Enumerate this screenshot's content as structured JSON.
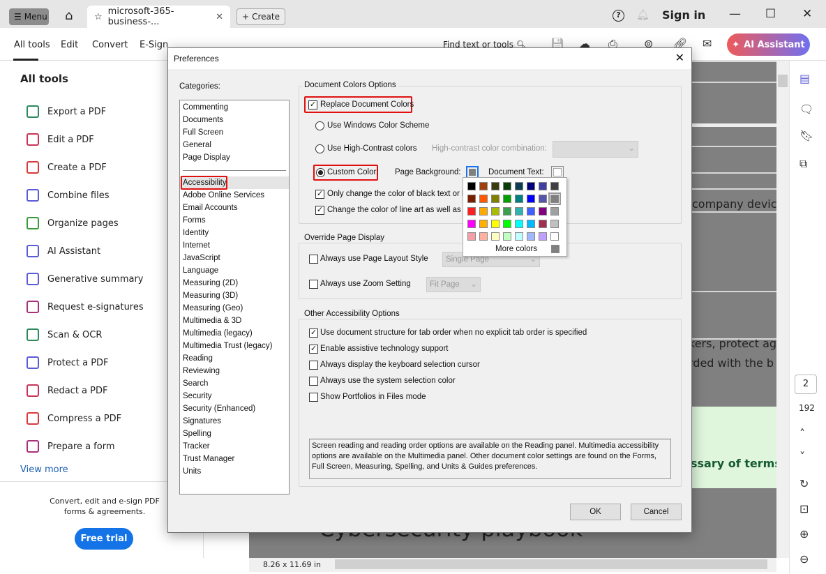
{
  "titlebar": {
    "menu": "Menu",
    "tab_title": "microsoft-365-business-...",
    "create": "Create",
    "sign_in": "Sign in"
  },
  "toolbar": {
    "tabs": [
      "All tools",
      "Edit",
      "Convert",
      "E-Sign"
    ],
    "find": "Find text or tools",
    "ai_assistant": "AI Assistant"
  },
  "left_panel": {
    "title": "All tools",
    "items": [
      {
        "label": "Export a PDF",
        "color": "#2a8a5c"
      },
      {
        "label": "Edit a PDF",
        "color": "#c8345a"
      },
      {
        "label": "Create a PDF",
        "color": "#d8393c"
      },
      {
        "label": "Combine files",
        "color": "#5b5bd6"
      },
      {
        "label": "Organize pages",
        "color": "#3a9a3a"
      },
      {
        "label": "AI Assistant",
        "color": "#5b5bd6"
      },
      {
        "label": "Generative summary",
        "color": "#5b5bd6"
      },
      {
        "label": "Request e-signatures",
        "color": "#a8307a"
      },
      {
        "label": "Scan & OCR",
        "color": "#2a8a5c"
      },
      {
        "label": "Protect a PDF",
        "color": "#5b5bd6"
      },
      {
        "label": "Redact a PDF",
        "color": "#c8345a"
      },
      {
        "label": "Compress a PDF",
        "color": "#d8393c"
      },
      {
        "label": "Prepare a form",
        "color": "#a8307a"
      }
    ],
    "view_more": "View more",
    "promo": "Convert, edit and e-sign PDF forms & agreements.",
    "free_trial": "Free trial"
  },
  "document": {
    "snippets": [
      "company devices",
      "kers, protect ag",
      "rded with the b",
      "ssary of terms.",
      "Cybersecurity playbook"
    ],
    "page_size": "8.26 x 11.69 in"
  },
  "right_rail": {
    "page": "2",
    "total": "192"
  },
  "dialog": {
    "title": "Preferences",
    "categories_label": "Categories:",
    "categories_top": [
      "Commenting",
      "Documents",
      "Full Screen",
      "General",
      "Page Display"
    ],
    "categories": [
      "Accessibility",
      "Adobe Online Services",
      "Email Accounts",
      "Forms",
      "Identity",
      "Internet",
      "JavaScript",
      "Language",
      "Measuring (2D)",
      "Measuring (3D)",
      "Measuring (Geo)",
      "Multimedia & 3D",
      "Multimedia (legacy)",
      "Multimedia Trust (legacy)",
      "Reading",
      "Reviewing",
      "Search",
      "Security",
      "Security (Enhanced)",
      "Signatures",
      "Spelling",
      "Tracker",
      "Trust Manager",
      "Units"
    ],
    "selected_category": "Accessibility",
    "doc_colors": {
      "group": "Document Colors Options",
      "replace": "Replace Document Colors",
      "replace_checked": true,
      "windows": "Use Windows Color Scheme",
      "high_contrast": "Use High-Contrast colors",
      "hc_combo_label": "High-contrast color combination:",
      "custom": "Custom Color:",
      "custom_selected": true,
      "page_bg": "Page Background:",
      "page_bg_color": "#808080",
      "doc_text": "Document Text:",
      "doc_text_color": "#ffffff",
      "only_black": "Only change the color of black text or li",
      "only_black_checked": true,
      "line_art": "Change the color of line art as well as t",
      "line_art_checked": true
    },
    "override": {
      "group": "Override Page Display",
      "layout": "Always use Page Layout Style",
      "layout_value": "Single Page",
      "zoom": "Always use Zoom Setting",
      "zoom_value": "Fit Page"
    },
    "other": {
      "group": "Other Accessibility Options",
      "options": [
        {
          "label": "Use document structure for tab order when no explicit tab order is specified",
          "checked": true
        },
        {
          "label": "Enable assistive technology support",
          "checked": true
        },
        {
          "label": "Always display the keyboard selection cursor",
          "checked": false
        },
        {
          "label": "Always use the system selection color",
          "checked": false
        },
        {
          "label": "Show Portfolios in Files mode",
          "checked": false
        }
      ],
      "info": "Screen reading and reading order options are available on the Reading panel. Multimedia accessibility options are available on the Multimedia panel. Other document color settings are found on the Forms, Full Screen, Measuring, Spelling, and Units & Guides preferences."
    },
    "ok": "OK",
    "cancel": "Cancel",
    "palette": {
      "more_colors": "More colors",
      "selected": "#808080",
      "colors": [
        "#000000",
        "#a0410d",
        "#3b3b0e",
        "#0b3d0b",
        "#0d3d52",
        "#00007a",
        "#4040a0",
        "#404040",
        "#7a2000",
        "#ff5a00",
        "#808000",
        "#00a000",
        "#008080",
        "#0000ff",
        "#5555aa",
        "#808080",
        "#ff2020",
        "#ffaa00",
        "#aabb00",
        "#3aa050",
        "#33b0b0",
        "#4060ff",
        "#800080",
        "#a0a0a0",
        "#ff00ff",
        "#ffb000",
        "#ffff00",
        "#00ff00",
        "#00ffff",
        "#00bbff",
        "#a03050",
        "#c0c0c0",
        "#f5a0a8",
        "#ffb0a0",
        "#ffffc0",
        "#c0ffc0",
        "#c0ffff",
        "#a0b8ff",
        "#c0a0ff",
        "#ffffff"
      ]
    }
  }
}
